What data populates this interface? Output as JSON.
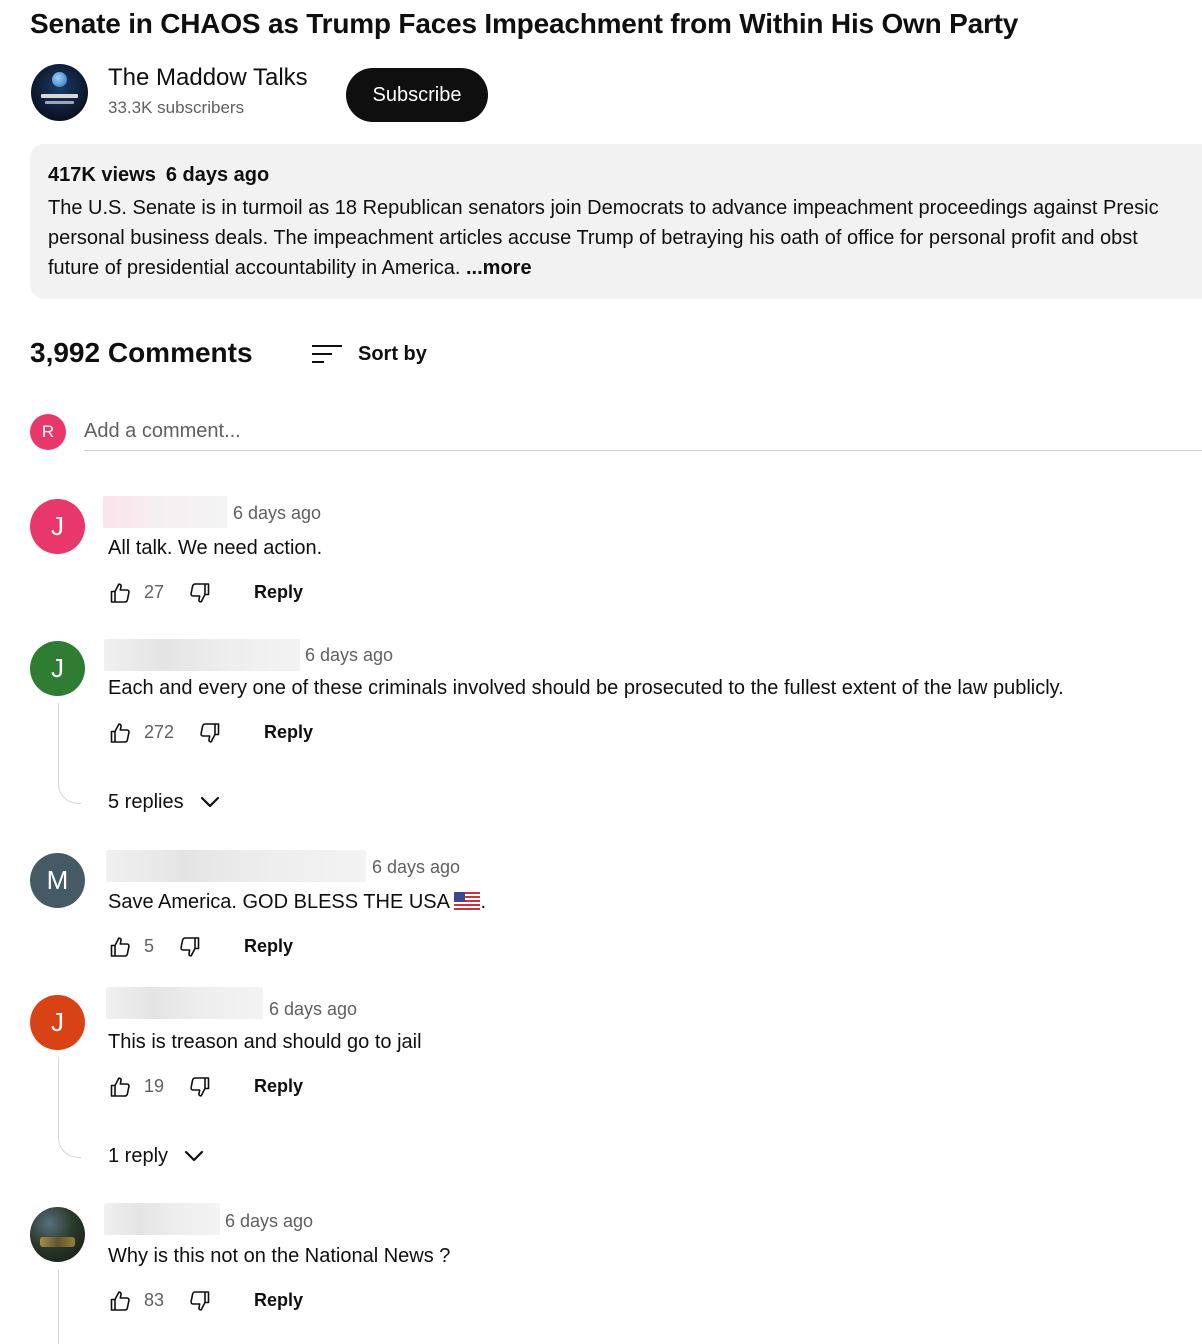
{
  "video": {
    "title": "Senate in CHAOS as Trump Faces Impeachment from Within His Own Party"
  },
  "channel": {
    "name": "The Maddow Talks",
    "subscribers": "33.3K subscribers",
    "subscribe_label": "Subscribe"
  },
  "description": {
    "views": "417K views",
    "age": "6 days ago",
    "line1": "The U.S. Senate is in turmoil as 18 Republican senators join Democrats to advance impeachment proceedings against Presic",
    "line2": "personal business deals. The impeachment articles accuse Trump of betraying his oath of office for personal profit and obst",
    "line3": "future of presidential accountability in America. ",
    "more_label": "...more"
  },
  "comments_header": {
    "count": "3,992 Comments",
    "sort_label": "Sort by"
  },
  "add_comment": {
    "avatar_letter": "R",
    "avatar_color": "#e8386b",
    "placeholder": "Add a comment..."
  },
  "comments": [
    {
      "avatar_letter": "J",
      "avatar_color": "#e8386b",
      "time": "6 days ago",
      "text": "All talk. We need action.",
      "likes": "27",
      "reply_label": "Reply"
    },
    {
      "avatar_letter": "J",
      "avatar_color": "#2e7d32",
      "time": "6 days ago",
      "text": "Each and every one of these criminals involved should be prosecuted to the fullest extent of the law publicly.",
      "likes": "272",
      "reply_label": "Reply",
      "replies_label": "5 replies"
    },
    {
      "avatar_letter": "M",
      "avatar_color": "#455a64",
      "time": "6 days ago",
      "text": "Save America.  GOD BLESS THE USA ",
      "text_suffix": ".",
      "likes": "5",
      "reply_label": "Reply"
    },
    {
      "avatar_letter": "J",
      "avatar_color": "#d84315",
      "time": "6 days ago",
      "text": "This is treason and should go to jail",
      "likes": "19",
      "reply_label": "Reply",
      "replies_label": "1 reply"
    },
    {
      "avatar_letter": "",
      "time": "6 days ago",
      "text": "Why is this not on the National News ?",
      "likes": "83",
      "reply_label": "Reply"
    }
  ],
  "icons": {
    "sort": "sort-icon",
    "like": "thumbs-up-icon",
    "dislike": "thumbs-down-icon",
    "expand": "chevron-down-icon",
    "flag": "us-flag-icon"
  }
}
